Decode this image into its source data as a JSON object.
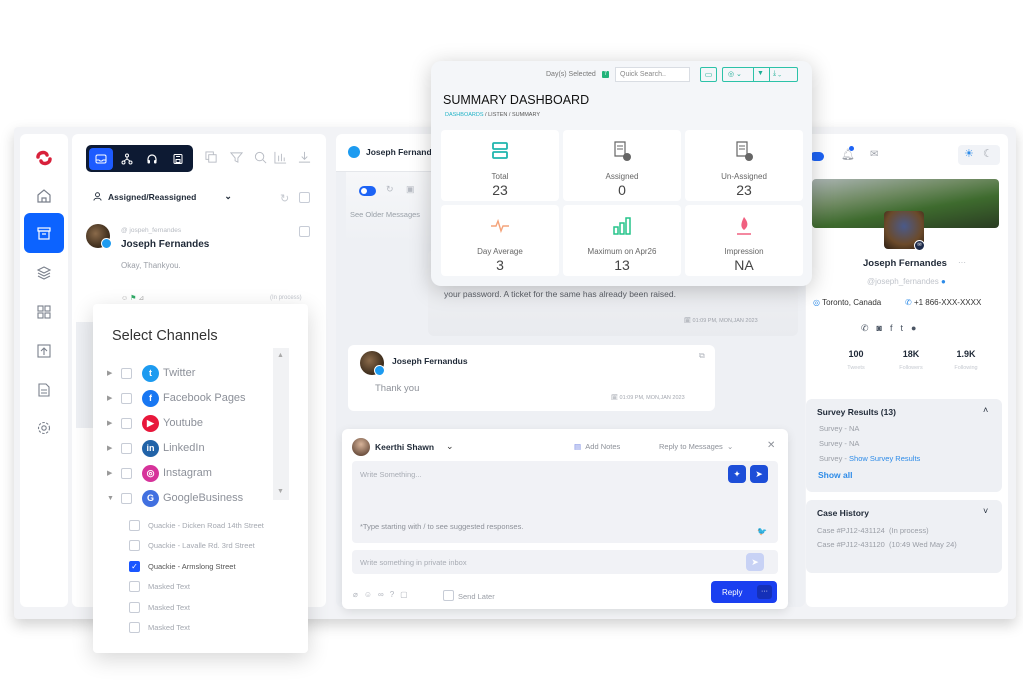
{
  "sidebar": {
    "logo": "app-logo",
    "items": [
      {
        "icon": "home-icon",
        "active": false
      },
      {
        "icon": "archive-inbox-icon",
        "active": true
      },
      {
        "icon": "layers-icon",
        "active": false
      },
      {
        "icon": "grid-icon",
        "active": false
      },
      {
        "icon": "upload-icon",
        "active": false
      },
      {
        "icon": "document-icon",
        "active": false
      },
      {
        "icon": "settings-icon",
        "active": false
      }
    ]
  },
  "inbox": {
    "modes": [
      "inbox-icon",
      "hierarchy-icon",
      "headphones-icon",
      "save-icon"
    ],
    "tools": [
      "copy-icon",
      "filter-icon",
      "search-icon",
      "bar-chart-icon",
      "download-icon"
    ],
    "filter_label": "Assigned/Reassigned",
    "conversation": {
      "handle": "@ jospeh_fernandes",
      "name": "Joseph Fernandes",
      "preview": "Okay, Thankyou.",
      "status": "(In process)"
    }
  },
  "channels": {
    "title": "Select Channels",
    "items": [
      {
        "label": "Twitter",
        "color": "#1d9bf0",
        "glyph": "t",
        "expanded": false
      },
      {
        "label": "Facebook Pages",
        "color": "#1877f2",
        "glyph": "f",
        "expanded": false
      },
      {
        "label": "Youtube",
        "color": "#e8173b",
        "glyph": "▶",
        "expanded": false
      },
      {
        "label": "LinkedIn",
        "color": "#2163a8",
        "glyph": "in",
        "expanded": false
      },
      {
        "label": "Instagram",
        "color": "#d6339a",
        "glyph": "◎",
        "expanded": false
      },
      {
        "label": "GoogleBusiness",
        "color": "#4170e0",
        "glyph": "G",
        "expanded": true
      }
    ],
    "sub_items": [
      {
        "label": "Quackie - Dicken Road 14th Street",
        "checked": false
      },
      {
        "label": "Quackie - Lavalle Rd. 3rd Street",
        "checked": false
      },
      {
        "label": "Quackie - Armslong Street",
        "checked": true
      },
      {
        "label": "Masked Text",
        "checked": false
      },
      {
        "label": "Masked Text",
        "checked": false
      },
      {
        "label": "Masked Text",
        "checked": false
      }
    ]
  },
  "conversation": {
    "header_name": "Joseph Fernandus",
    "see_older": "See Older Messages",
    "agent_message_tail": "your password. A ticket for the same has already been raised.",
    "agent_message_time": "01:09 PM, MON,JAN 2023",
    "customer_name": "Joseph Fernandus",
    "customer_message": "Thank you",
    "customer_message_time": "01:09 PM, MON,JAN 2023"
  },
  "summary": {
    "days_selected_label": "Day(s) Selected",
    "days_selected_badge": "7",
    "search_placeholder": "Quick Search..",
    "title": "SUMMARY DASHBOARD",
    "breadcrumb": [
      "DASHBOARDS",
      "LISTEN",
      "SUMMARY"
    ],
    "stats": [
      {
        "label": "Total",
        "value": "23",
        "icon": "server-icon",
        "color": "#1fb5ad"
      },
      {
        "label": "Assigned",
        "value": "0",
        "icon": "document-check-icon",
        "color": "#666666"
      },
      {
        "label": "Un-Assigned",
        "value": "23",
        "icon": "document-x-icon",
        "color": "#666666"
      },
      {
        "label": "Day Average",
        "value": "3",
        "icon": "pulse-icon",
        "color": "#f4a37a"
      },
      {
        "label": "Maximum on Apr26",
        "value": "13",
        "icon": "signal-bars-icon",
        "color": "#25c48a"
      },
      {
        "label": "Impression",
        "value": "NA",
        "icon": "flame-icon",
        "color": "#f06080"
      }
    ]
  },
  "composer": {
    "agent_name": "Keerthi Shawn",
    "add_notes": "Add Notes",
    "reply_mode": "Reply to Messages",
    "placeholder": "Write Something...",
    "hint": "*Type starting with / to see suggested responses.",
    "private_placeholder": "Write something in private inbox",
    "send_later": "Send Later",
    "reply_button": "Reply",
    "more_button": "···"
  },
  "profile": {
    "name": "Joseph Fernandes",
    "handle": "@joseph_fernandes",
    "location": "Toronto, Canada",
    "phone": "+1 866-XXX-XXXX",
    "stats": [
      {
        "value": "100",
        "label": "Tweets"
      },
      {
        "value": "18K",
        "label": "Followers"
      },
      {
        "value": "1.9K",
        "label": "Following"
      }
    ],
    "survey": {
      "title": "Survey Results (13)",
      "rows": [
        {
          "prefix": "Survey - ",
          "value": "NA",
          "link": false
        },
        {
          "prefix": "Survey - ",
          "value": "NA",
          "link": false
        },
        {
          "prefix": "Survey - ",
          "value": "Show Survey Results",
          "link": true
        }
      ],
      "show_all": "Show all"
    },
    "case_history": {
      "title": "Case History",
      "rows": [
        "Case #PJ12-431124  (In process)",
        "Case #PJ12-431120  (10:49 Wed May 24)"
      ]
    }
  }
}
